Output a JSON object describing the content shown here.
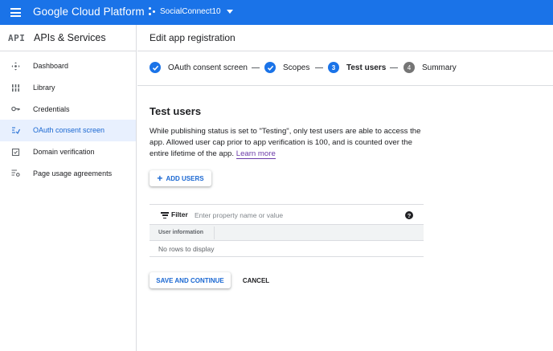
{
  "topbar": {
    "brand": "Google Cloud Platform",
    "project": "SocialConnect10",
    "color": "#1a73e8"
  },
  "sidebar": {
    "logo": "API",
    "title": "APIs & Services",
    "items": [
      {
        "label": "Dashboard",
        "icon": "dashboard-icon"
      },
      {
        "label": "Library",
        "icon": "library-icon"
      },
      {
        "label": "Credentials",
        "icon": "key-icon"
      },
      {
        "label": "OAuth consent screen",
        "icon": "consent-icon",
        "active": true
      },
      {
        "label": "Domain verification",
        "icon": "checkbox-icon"
      },
      {
        "label": "Page usage agreements",
        "icon": "settings-list-icon"
      }
    ]
  },
  "page": {
    "title": "Edit app registration"
  },
  "stepper": {
    "steps": [
      {
        "label": "OAuth consent screen",
        "state": "done"
      },
      {
        "label": "Scopes",
        "state": "done"
      },
      {
        "label": "Test users",
        "state": "current",
        "number": "3"
      },
      {
        "label": "Summary",
        "state": "todo",
        "number": "4"
      }
    ]
  },
  "test_users": {
    "title": "Test users",
    "description": "While publishing status is set to \"Testing\", only test users are able to access the app. Allowed user cap prior to app verification is 100, and is counted over the entire lifetime of the app.",
    "learn_more": "Learn more",
    "add_users_label": "ADD USERS"
  },
  "table": {
    "filter_label": "Filter",
    "filter_placeholder": "Enter property name or value",
    "help": "?",
    "column": "User information",
    "empty": "No rows to display"
  },
  "actions": {
    "save": "SAVE AND CONTINUE",
    "cancel": "CANCEL"
  }
}
